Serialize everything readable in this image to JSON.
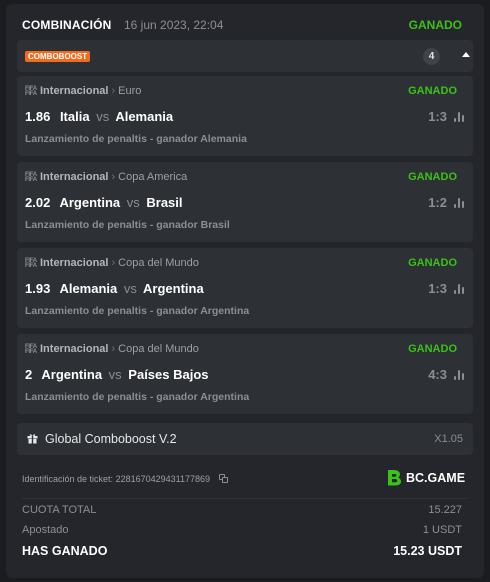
{
  "header": {
    "title": "COMBINACIÓN",
    "date": "16 jun 2023, 22:04",
    "status": "GANADO"
  },
  "combo": {
    "badge": "COMBOBOOST",
    "count": "4"
  },
  "bets": [
    {
      "category": "Internacional",
      "league": "Euro",
      "status": "GANADO",
      "odds": "1.86",
      "home": "Italia",
      "vs": "vs",
      "away": "Alemania",
      "score": "1:3",
      "market": "Lanzamiento de penaltis - ganador Alemania"
    },
    {
      "category": "Internacional",
      "league": "Copa America",
      "status": "GANADO",
      "odds": "2.02",
      "home": "Argentina",
      "vs": "vs",
      "away": "Brasil",
      "score": "1:2",
      "market": "Lanzamiento de penaltis - ganador Brasil"
    },
    {
      "category": "Internacional",
      "league": "Copa del Mundo",
      "status": "GANADO",
      "odds": "1.93",
      "home": "Alemania",
      "vs": "vs",
      "away": "Argentina",
      "score": "1:3",
      "market": "Lanzamiento de penaltis - ganador Argentina"
    },
    {
      "category": "Internacional",
      "league": "Copa del Mundo",
      "status": "GANADO",
      "odds": "2",
      "home": "Argentina",
      "vs": "vs",
      "away": "Países Bajos",
      "score": "4:3",
      "market": "Lanzamiento de penaltis - ganador Argentina"
    }
  ],
  "global_boost": {
    "label": "Global Comboboost V.2",
    "multiplier": "X1.05"
  },
  "ticket": {
    "label": "Identificación de ticket:",
    "id": "2281670429431177869"
  },
  "brand": {
    "name": "BC.GAME",
    "logo_text": "BC",
    "logo_icon": "bc-game-logo"
  },
  "summary": {
    "odds_label": "CUOTA TOTAL",
    "odds_value": "15.227",
    "stake_label": "Apostado",
    "stake_value": "1 USDT",
    "won_label": "HAS GANADO",
    "won_value": "15.23 USDT"
  },
  "colors": {
    "win_green": "#3bc117",
    "combo_orange": "#ef6c1e",
    "card_bg": "#24262b",
    "panel_bg": "#2d3035",
    "muted_text": "#8a8e96"
  }
}
